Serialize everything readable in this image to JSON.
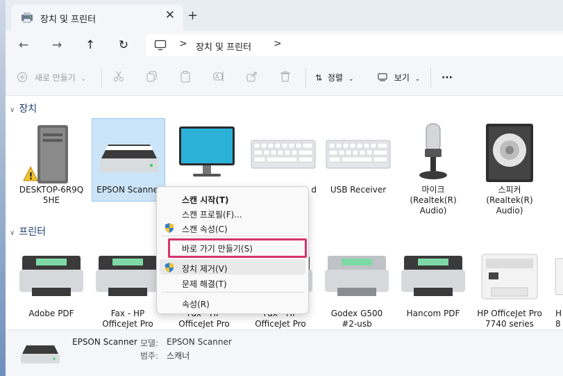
{
  "window": {
    "tab_title": "장치 및 프린터",
    "new_tab": "+",
    "close": "✕"
  },
  "nav": {
    "back": "←",
    "forward": "→",
    "up": "↑",
    "refresh": "↻",
    "breadcrumb": "장치 및 프린터",
    "sep": ">"
  },
  "toolbar": {
    "new_label": "새로 만들기",
    "sort_label": "정렬",
    "view_label": "보기",
    "more": "···"
  },
  "groups": {
    "devices": "장치",
    "printers": "프린터"
  },
  "devices": [
    {
      "line1": "DESKTOP-6R9Q",
      "line2": "5HE"
    },
    {
      "line1": "EPSON Scanner",
      "line2": ""
    },
    {
      "line1": "",
      "line2": ""
    },
    {
      "line1": "d",
      "line2": ""
    },
    {
      "line1": "USB Receiver",
      "line2": ""
    },
    {
      "line1": "마이크",
      "line2": "(Realtek(R)",
      "line3": "Audio)"
    },
    {
      "line1": "스피커",
      "line2": "(Realtek(R)",
      "line3": "Audio)"
    }
  ],
  "printers": [
    {
      "line1": "Adobe PDF",
      "line2": ""
    },
    {
      "line1": "Fax - HP",
      "line2": "OfficeJet Pro"
    },
    {
      "line1": "Fax - HP",
      "line2": "OfficeJet Pro"
    },
    {
      "line1": "Fax - HP",
      "line2": "OfficeJet Pro"
    },
    {
      "line1": "Godex G500",
      "line2": "#2-usb"
    },
    {
      "line1": "Hancom PDF",
      "line2": ""
    },
    {
      "line1": "HP OfficeJet Pro",
      "line2": "7740 series"
    },
    {
      "line1": "H",
      "line2": "8"
    }
  ],
  "context_menu": {
    "scan_start": "스캔 시작(T)",
    "scan_profile": "스캔 프로필(F)...",
    "scan_props": "스캔 속성(C)",
    "create_shortcut": "바로 가기 만들기(S)",
    "remove_device": "장치 제거(V)",
    "troubleshoot": "문제 해결(T)",
    "properties": "속성(R)"
  },
  "status": {
    "name": "EPSON Scanner",
    "model_key": "모델:",
    "model_val": "EPSON Scanner",
    "cat_key": "범주:",
    "cat_val": "스캐너"
  },
  "colors": {
    "selection": "#cce4f7",
    "highlight_box": "#d6336c",
    "group_header": "#1f3f75"
  }
}
